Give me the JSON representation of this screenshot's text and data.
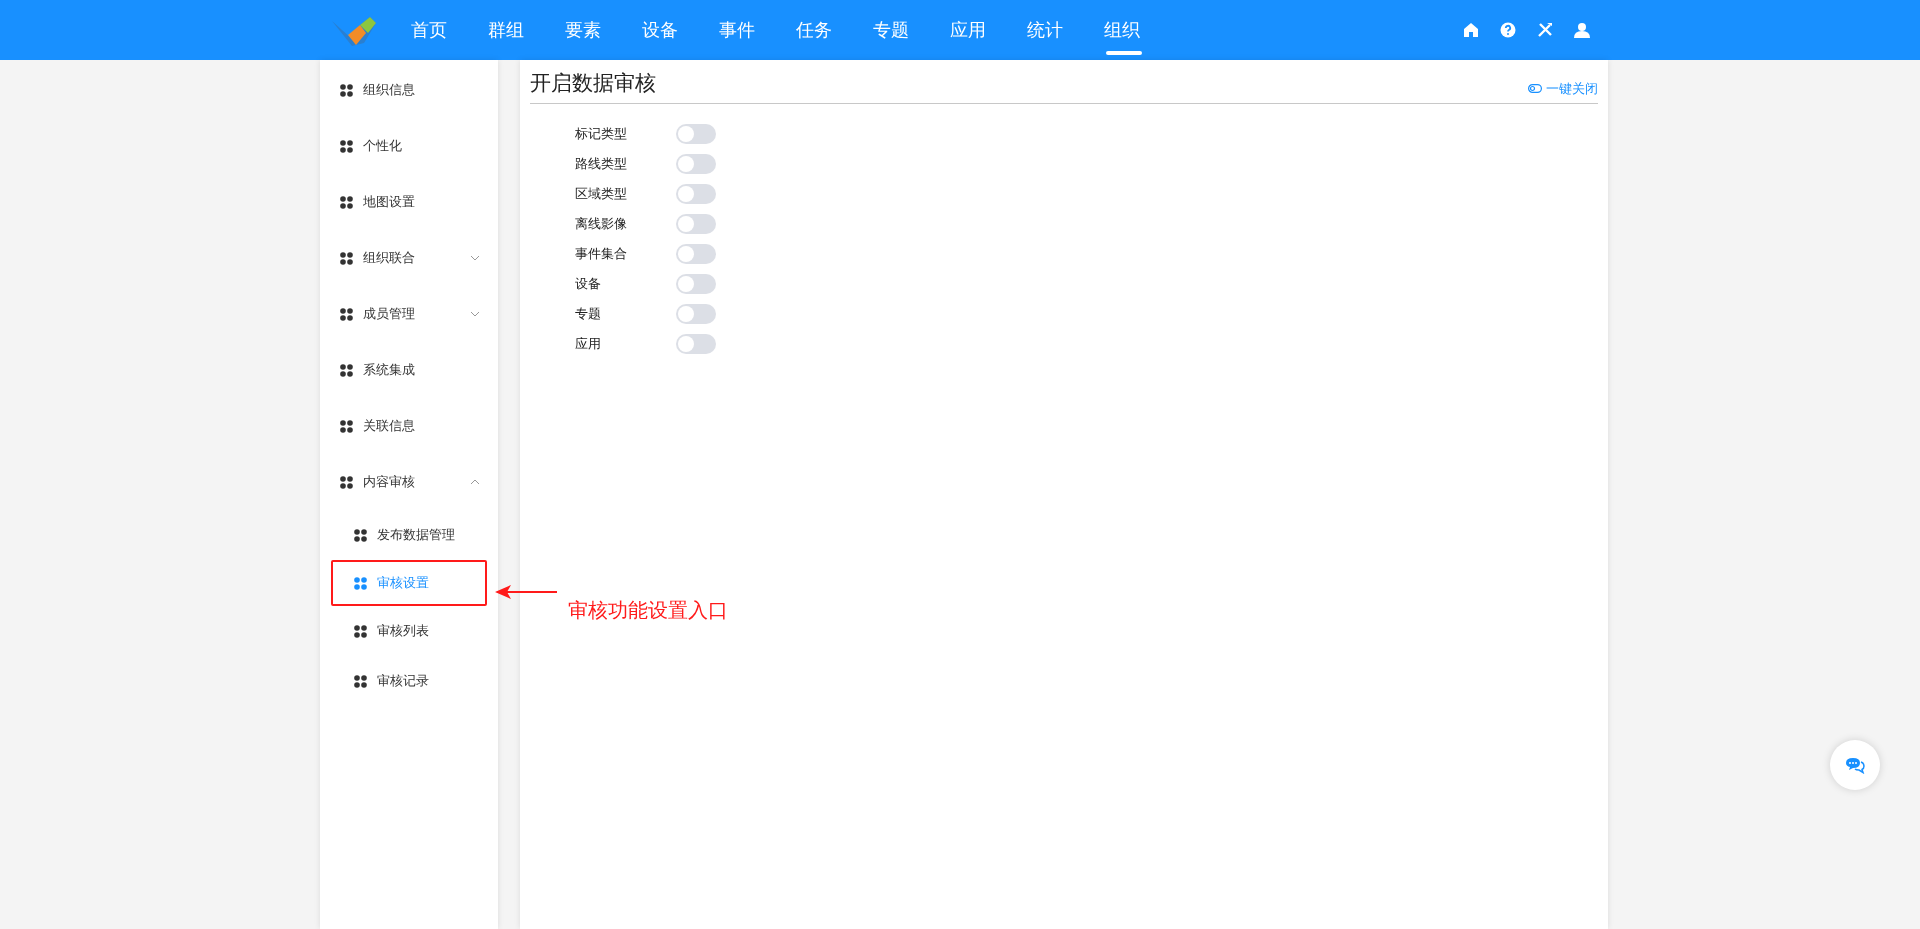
{
  "nav": [
    {
      "label": "首页",
      "selected": false
    },
    {
      "label": "群组",
      "selected": false
    },
    {
      "label": "要素",
      "selected": false
    },
    {
      "label": "设备",
      "selected": false
    },
    {
      "label": "事件",
      "selected": false
    },
    {
      "label": "任务",
      "selected": false
    },
    {
      "label": "专题",
      "selected": false
    },
    {
      "label": "应用",
      "selected": false
    },
    {
      "label": "统计",
      "selected": false
    },
    {
      "label": "组织",
      "selected": true
    }
  ],
  "sidebar": {
    "items": [
      {
        "label": "组织信息",
        "selected": false
      },
      {
        "label": "个性化",
        "selected": false
      },
      {
        "label": "地图设置",
        "selected": false
      },
      {
        "label": "组织联合",
        "selected": false,
        "expanded": false
      },
      {
        "label": "成员管理",
        "selected": false,
        "expanded": false
      },
      {
        "label": "系统集成",
        "selected": false
      },
      {
        "label": "关联信息",
        "selected": false
      },
      {
        "label": "内容审核",
        "selected": false,
        "expanded": true,
        "children": [
          {
            "label": "发布数据管理",
            "selected": false
          },
          {
            "label": "审核设置",
            "selected": true
          },
          {
            "label": "审核列表",
            "selected": false
          },
          {
            "label": "审核记录",
            "selected": false
          }
        ]
      }
    ]
  },
  "panel": {
    "title": "开启数据审核",
    "action": "一键关闭",
    "settings": [
      {
        "label": "标记类型",
        "on": false
      },
      {
        "label": "路线类型",
        "on": false
      },
      {
        "label": "区域类型",
        "on": false
      },
      {
        "label": "离线影像",
        "on": false
      },
      {
        "label": "事件集合",
        "on": false
      },
      {
        "label": "设备",
        "on": false
      },
      {
        "label": "专题",
        "on": false
      },
      {
        "label": "应用",
        "on": false
      }
    ]
  },
  "annotation": {
    "text": "审核功能设置入口"
  }
}
